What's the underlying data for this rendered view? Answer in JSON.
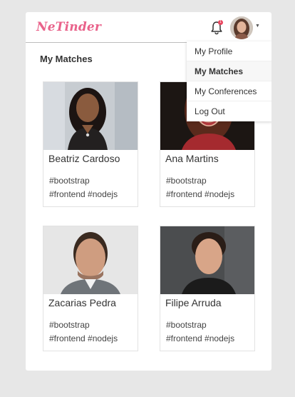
{
  "brand": {
    "name": "NeTinder",
    "color": "#e9628a"
  },
  "notifications": {
    "icon": "bell-icon",
    "badge_count": "1"
  },
  "user_menu": {
    "items": [
      {
        "label": "My Profile",
        "active": false
      },
      {
        "label": "My Matches",
        "active": true
      },
      {
        "label": "My Conferences",
        "active": false
      },
      {
        "label": "Log Out",
        "active": false
      }
    ]
  },
  "page": {
    "title": "My Matches"
  },
  "matches": [
    {
      "name": "Beatriz Cardoso",
      "tags_line1": "#bootstrap",
      "tags_line2": "#frontend #nodejs"
    },
    {
      "name": "Ana Martins",
      "tags_line1": "#bootstrap",
      "tags_line2": "#frontend #nodejs"
    },
    {
      "name": "Zacarias Pedra",
      "tags_line1": "#bootstrap",
      "tags_line2": "#frontend #nodejs"
    },
    {
      "name": "Filipe Arruda",
      "tags_line1": "#bootstrap",
      "tags_line2": "#frontend #nodejs"
    }
  ]
}
